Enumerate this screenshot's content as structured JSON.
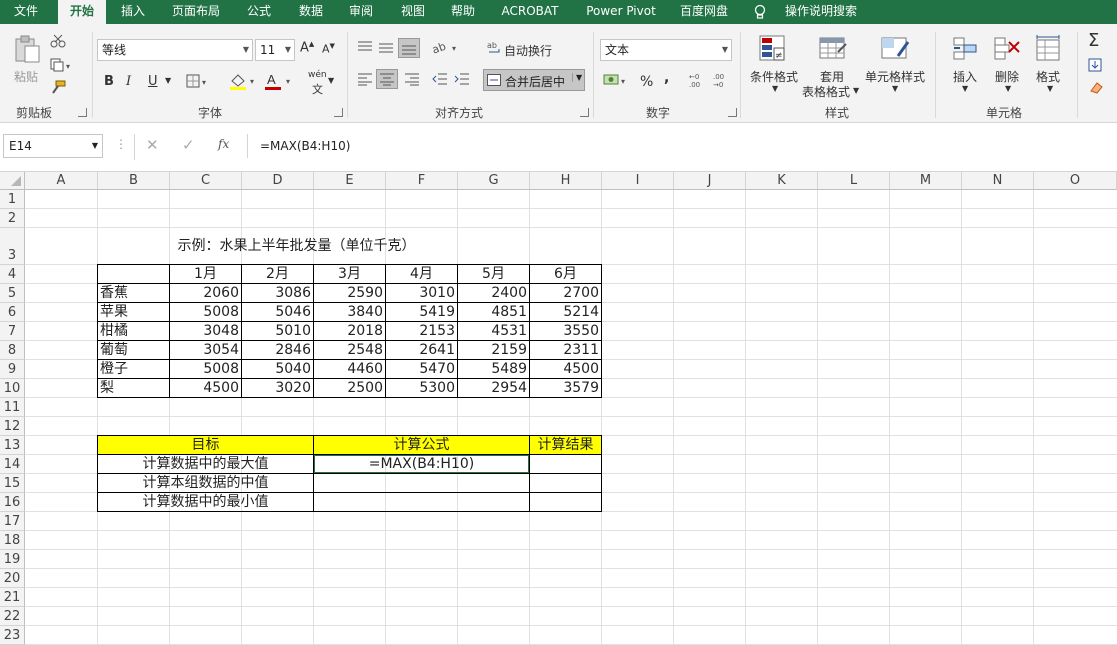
{
  "tabs": [
    "文件",
    "开始",
    "插入",
    "页面布局",
    "公式",
    "数据",
    "审阅",
    "视图",
    "帮助",
    "ACROBAT",
    "Power Pivot",
    "百度网盘",
    "操作说明搜索"
  ],
  "ribbon": {
    "clipboard": {
      "title": "剪贴板",
      "paste": "粘贴"
    },
    "font": {
      "title": "字体",
      "name": "等线",
      "size": "11",
      "bold": "B",
      "italic": "I",
      "underline": "U",
      "grow": "A",
      "shrink": "A",
      "phonetic": "wén"
    },
    "align": {
      "title": "对齐方式",
      "wrap": "自动换行",
      "merge": "合并后居中"
    },
    "number": {
      "title": "数字",
      "format": "文本",
      "percent": "%",
      "comma": ","
    },
    "styles": {
      "title": "样式",
      "cond": "条件格式",
      "table1": "套用",
      "table2": "表格格式",
      "cell": "单元格样式"
    },
    "cells": {
      "title": "单元格",
      "insert": "插入",
      "delete": "删除",
      "format": "格式"
    },
    "edit": {
      "sum": "Σ"
    }
  },
  "formula_bar": {
    "name_box": "E14",
    "fx": "fx",
    "formula": "=MAX(B4:H10)"
  },
  "columns": [
    "A",
    "B",
    "C",
    "D",
    "E",
    "F",
    "G",
    "H",
    "I",
    "J",
    "K",
    "L",
    "M",
    "N",
    "O"
  ],
  "rows": [
    "1",
    "2",
    "3",
    "4",
    "5",
    "6",
    "7",
    "8",
    "9",
    "10",
    "11",
    "12",
    "13",
    "14",
    "15",
    "16",
    "17",
    "18",
    "19",
    "20",
    "21",
    "22",
    "23"
  ],
  "sheet": {
    "title": "示例：水果上半年批发量（单位千克）",
    "months": [
      "1月",
      "2月",
      "3月",
      "4月",
      "5月",
      "6月"
    ],
    "fruits": [
      {
        "name": "香蕉",
        "values": [
          "2060",
          "3086",
          "2590",
          "3010",
          "2400",
          "2700"
        ]
      },
      {
        "name": "苹果",
        "values": [
          "5008",
          "5046",
          "3840",
          "5419",
          "4851",
          "5214"
        ]
      },
      {
        "name": "柑橘",
        "values": [
          "3048",
          "5010",
          "2018",
          "2153",
          "4531",
          "3550"
        ]
      },
      {
        "name": "葡萄",
        "values": [
          "3054",
          "2846",
          "2548",
          "2641",
          "2159",
          "2311"
        ]
      },
      {
        "name": "橙子",
        "values": [
          "5008",
          "5040",
          "4460",
          "5470",
          "5489",
          "4500"
        ]
      },
      {
        "name": "梨",
        "values": [
          "4500",
          "3020",
          "2500",
          "5300",
          "2954",
          "3579"
        ]
      }
    ],
    "task_headers": [
      "目标",
      "计算公式",
      "计算结果"
    ],
    "tasks": [
      {
        "goal": "计算数据中的最大值",
        "formula": "=MAX(B4:H10)",
        "result": ""
      },
      {
        "goal": "计算本组数据的中值",
        "formula": "",
        "result": ""
      },
      {
        "goal": "计算数据中的最小值",
        "formula": "",
        "result": ""
      }
    ]
  }
}
